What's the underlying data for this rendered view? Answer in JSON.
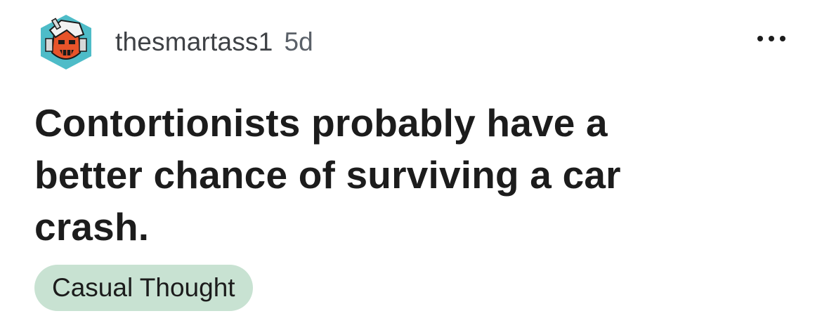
{
  "post": {
    "username": "thesmartass1",
    "age": "5d",
    "title": "Contortionists probably have a better chance of surviving a car crash.",
    "flair": "Casual Thought",
    "more_menu": "more-options-icon",
    "avatar_icon": "robot-avatar-icon"
  },
  "colors": {
    "flair_background": "#c8e2d2",
    "avatar_hex": "#4ebcc8",
    "avatar_face": "#e8542a"
  }
}
